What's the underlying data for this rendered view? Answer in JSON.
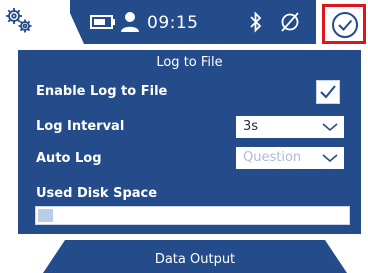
{
  "status_bar": {
    "time": "09:15",
    "icons": [
      "settings-gears-icon",
      "battery-icon",
      "user-icon",
      "bluetooth-icon",
      "no-connection-icon",
      "checkmark-circle-icon"
    ]
  },
  "panel": {
    "title": "Log to File",
    "enable_log_label": "Enable Log to File",
    "enable_log_checked": true,
    "log_interval_label": "Log Interval",
    "log_interval_value": "3s",
    "auto_log_label": "Auto Log",
    "auto_log_value": "Question",
    "disk_space_label": "Used Disk Space",
    "disk_space_used_fraction": 0.05
  },
  "bottom_tab": {
    "label": "Data Output"
  },
  "colors": {
    "primary": "#244b8a",
    "highlight_border": "#e0141e",
    "disabled_text": "#a9bcd9"
  }
}
